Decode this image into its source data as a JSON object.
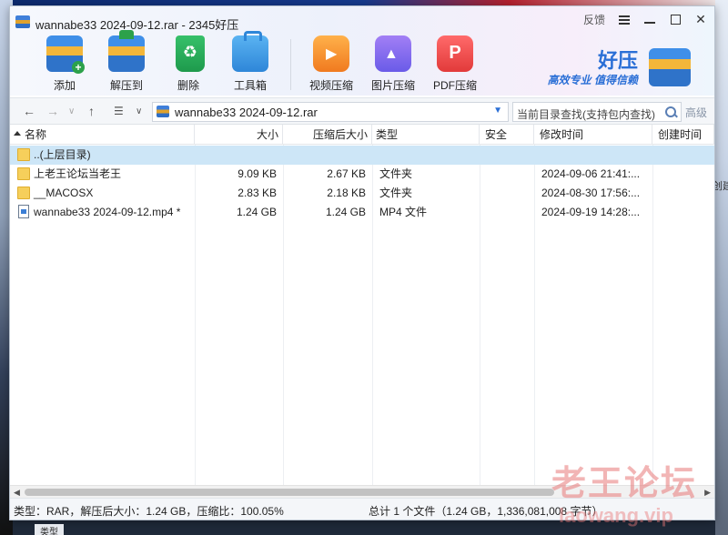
{
  "window": {
    "title": "wannabe33 2024-09-12.rar - 2345好压",
    "feedback": "反馈"
  },
  "toolbar": {
    "items": [
      {
        "label": "添加",
        "icon": "add-icon"
      },
      {
        "label": "解压到",
        "icon": "extract-icon"
      },
      {
        "label": "删除",
        "icon": "recycle-icon"
      },
      {
        "label": "工具箱",
        "icon": "toolbox-icon"
      },
      {
        "label": "视频压缩",
        "icon": "video-icon"
      },
      {
        "label": "图片压缩",
        "icon": "image-icon"
      },
      {
        "label": "PDF压缩",
        "icon": "pdf-icon"
      }
    ]
  },
  "brand": {
    "name": "好压",
    "slogan": "高效专业 值得信赖"
  },
  "address": {
    "path": "wannabe33 2024-09-12.rar",
    "search_placeholder": "当前目录查找(支持包内查找)",
    "advanced": "高级"
  },
  "columns": [
    "名称",
    "大小",
    "压缩后大小",
    "类型",
    "安全",
    "修改时间",
    "创建时间"
  ],
  "rows": [
    {
      "name": "..(上层目录)",
      "size": "",
      "packed": "",
      "type": "",
      "safe": "",
      "modified": "",
      "created": "",
      "icon": "folder-icon",
      "selected": true
    },
    {
      "name": "上老王论坛当老王",
      "size": "9.09 KB",
      "packed": "2.67 KB",
      "type": "文件夹",
      "safe": "",
      "modified": "2024-09-06 21:41:...",
      "created": "",
      "icon": "folder-icon",
      "selected": false
    },
    {
      "name": "__MACOSX",
      "size": "2.83 KB",
      "packed": "2.18 KB",
      "type": "文件夹",
      "safe": "",
      "modified": "2024-08-30 17:56:...",
      "created": "",
      "icon": "folder-icon",
      "selected": false
    },
    {
      "name": "wannabe33 2024-09-12.mp4 *",
      "size": "1.24 GB",
      "packed": "1.24 GB",
      "type": "MP4 文件",
      "safe": "",
      "modified": "2024-09-19 14:28:...",
      "created": "",
      "icon": "video-file-icon",
      "selected": false
    }
  ],
  "status": {
    "left": "类型：RAR，解压后大小：1.24 GB，压缩比：100.05%",
    "right": "总计 1 个文件（1.24 GB，1,336,081,008 字节）"
  },
  "watermark": {
    "text": "老王论坛",
    "url": "laowang.vip"
  },
  "desktop": {
    "right_hint": "创建",
    "bottom_tab": "类型"
  }
}
